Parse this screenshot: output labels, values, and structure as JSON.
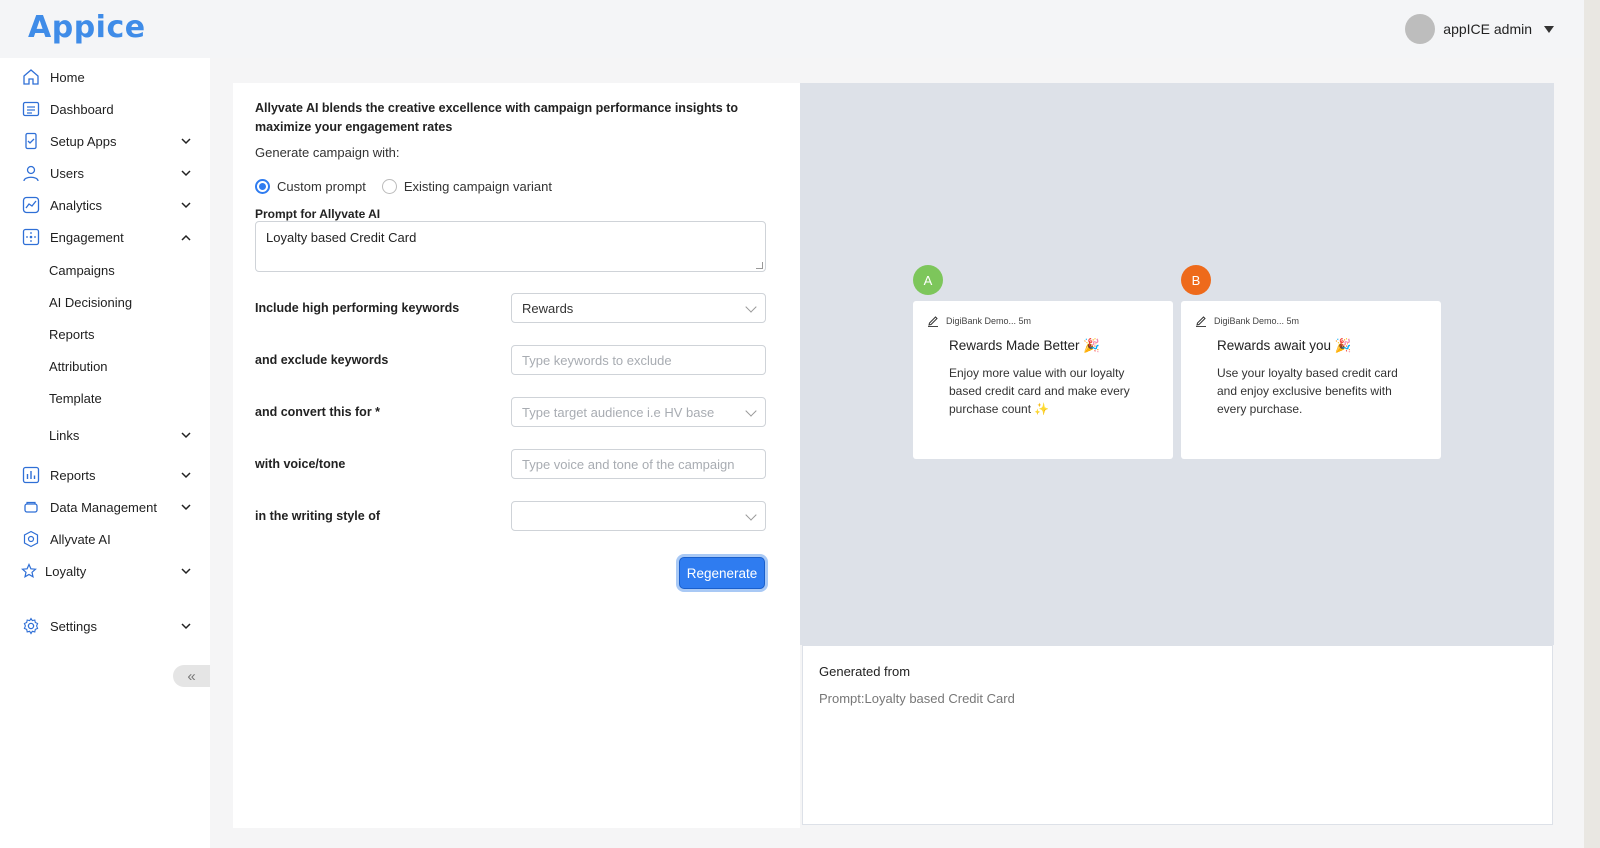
{
  "app": {
    "logo": "Appice"
  },
  "user": {
    "name": "appICE admin"
  },
  "sidebar": {
    "items": [
      {
        "label": "Home",
        "icon": "home-icon"
      },
      {
        "label": "Dashboard",
        "icon": "dashboard-icon"
      },
      {
        "label": "Setup Apps",
        "icon": "setup-apps-icon"
      },
      {
        "label": "Users",
        "icon": "user-icon"
      },
      {
        "label": "Analytics",
        "icon": "analytics-icon"
      },
      {
        "label": "Engagement",
        "icon": "engagement-icon"
      },
      {
        "label": "Reports",
        "icon": "reports-icon"
      },
      {
        "label": "Data Management",
        "icon": "database-icon"
      },
      {
        "label": "Allyvate AI",
        "icon": "ai-icon"
      },
      {
        "label": "Loyalty",
        "icon": "star-icon"
      },
      {
        "label": "Settings",
        "icon": "gear-icon"
      }
    ],
    "engagement_sub": [
      "Campaigns",
      "AI Decisioning",
      "Reports",
      "Attribution",
      "Template",
      "Links"
    ],
    "collapse_glyph": "«"
  },
  "form": {
    "intro": "Allyvate AI blends the creative excellence with campaign performance insights to maximize your engagement rates",
    "generate_with": "Generate campaign with:",
    "radio_custom": "Custom prompt",
    "radio_existing": "Existing campaign variant",
    "prompt_label": "Prompt for Allyvate AI",
    "prompt_value": "Loyalty based Credit Card",
    "include_label": "Include high performing keywords",
    "include_value": "Rewards",
    "exclude_label": "and exclude keywords",
    "exclude_placeholder": "Type keywords to exclude",
    "convert_label": "and convert this for *",
    "convert_placeholder": "Type target audience i.e HV base",
    "voice_label": "with voice/tone",
    "voice_placeholder": "Type voice and tone of the campaign",
    "style_label": "in the writing style of",
    "style_value": "",
    "regenerate": "Regenerate"
  },
  "preview": {
    "variants": [
      {
        "badge": "A",
        "color": "#7dc65b",
        "meta": "DigiBank Demo... 5m",
        "title": "Rewards Made Better 🎉",
        "body": "Enjoy more value with our loyalty based credit card and make every purchase count ✨"
      },
      {
        "badge": "B",
        "color": "#ee6a1b",
        "meta": "DigiBank Demo... 5m",
        "title": "Rewards await you 🎉",
        "body": "Use your loyalty based credit card and enjoy exclusive benefits with every purchase."
      }
    ]
  },
  "generated": {
    "title": "Generated from",
    "prompt": "Prompt:Loyalty based Credit Card"
  }
}
